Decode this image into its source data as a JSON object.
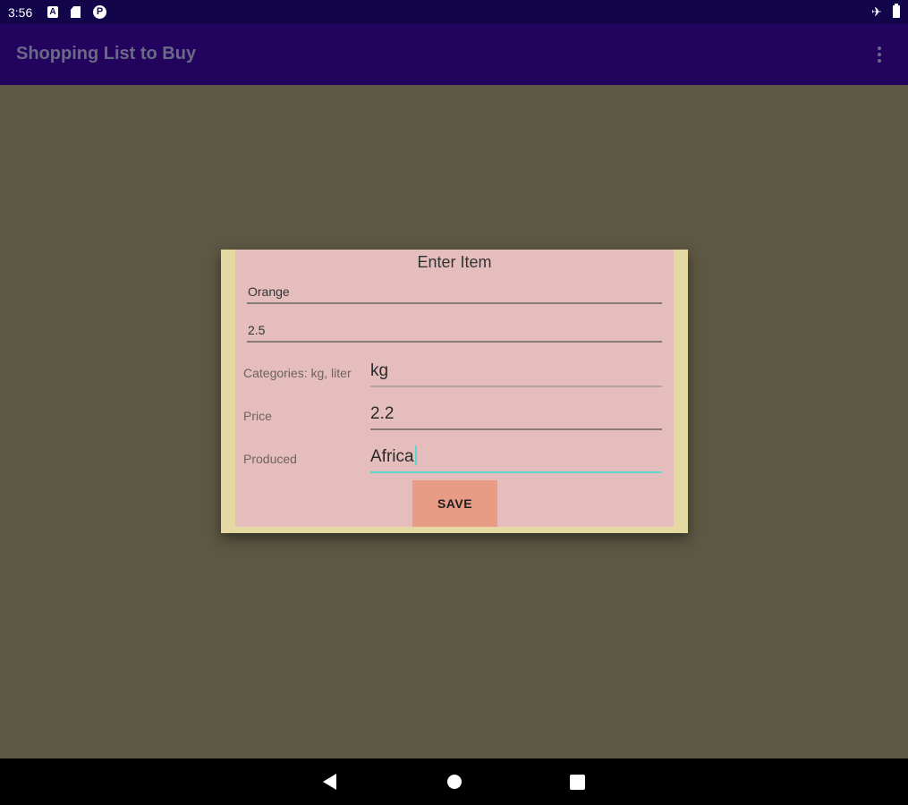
{
  "status_bar": {
    "time": "3:56",
    "icons": [
      "a-icon",
      "sd-card-icon",
      "p-icon",
      "airplane-icon",
      "battery-icon"
    ]
  },
  "app_bar": {
    "title": "Shopping List to Buy",
    "menu_icon": "overflow-menu-icon"
  },
  "dialog": {
    "title": "Enter Item",
    "item_name": "Orange",
    "quantity": "2.5",
    "unit_label": "Categories: kg, liter",
    "unit_value": "kg",
    "price_label": "Price",
    "price_value": "2.2",
    "produced_label": "Produced",
    "produced_value": "Africa",
    "save_label": "SAVE"
  },
  "nav_bar": {
    "icons": [
      "back-icon",
      "home-icon",
      "recents-icon"
    ]
  },
  "colors": {
    "status_bar": "#13054a",
    "app_bar": "#22045e",
    "background": "#5d5843",
    "dialog_frame": "#e5d9a3",
    "dialog_body": "#e5bdbd",
    "save_button": "#e89b85",
    "focus_accent": "#5fd6d0"
  }
}
